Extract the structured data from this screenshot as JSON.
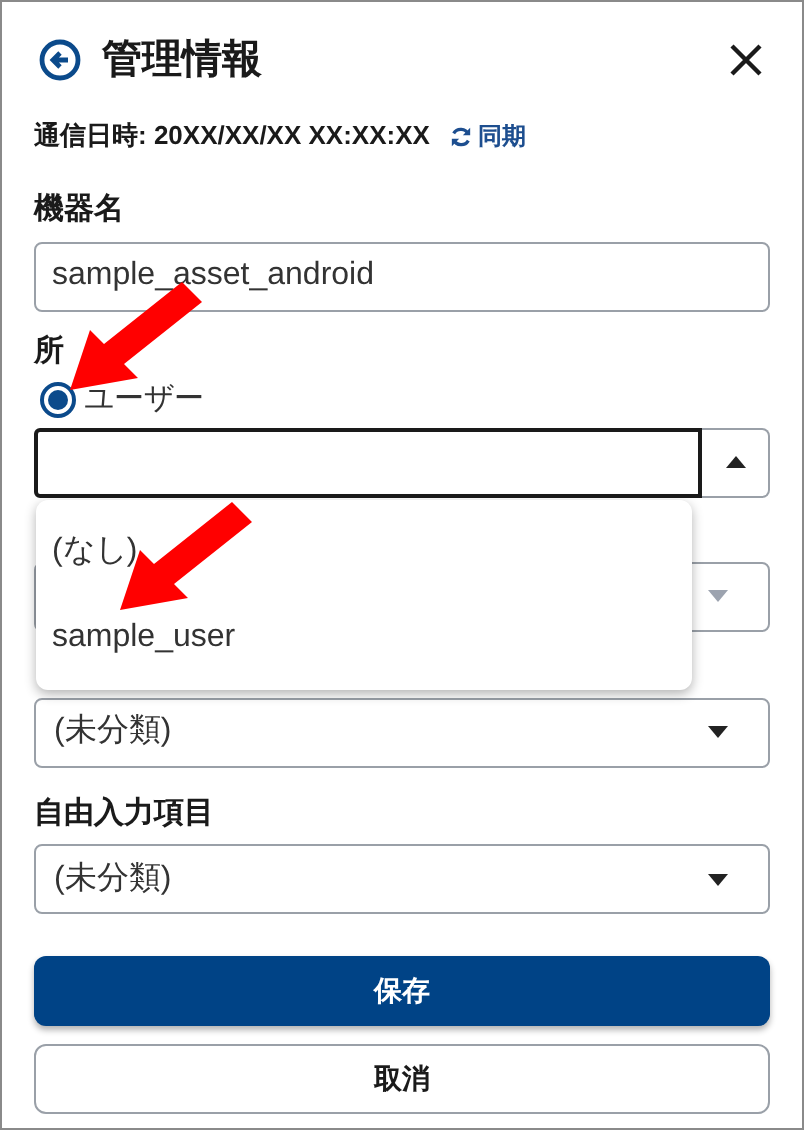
{
  "header": {
    "title": "管理情報"
  },
  "sync": {
    "label": "通信日時: 20XX/XX/XX XX:XX:XX",
    "action": "同期"
  },
  "device_name": {
    "label": "機器名",
    "value": "sample_asset_android"
  },
  "affiliation": {
    "label": "所",
    "radios": [
      {
        "label": "ユーザー",
        "selected": true
      }
    ],
    "combobox": {
      "expanded": true
    },
    "options": [
      {
        "label": "(なし)"
      },
      {
        "label": "sample_user"
      }
    ]
  },
  "hidden_select": {
    "disabled": true
  },
  "category_select": {
    "value": "(未分類)"
  },
  "free_input": {
    "label": "自由入力項目",
    "value": "(未分類)"
  },
  "buttons": [
    {
      "label": "保存",
      "kind": "primary"
    },
    {
      "label": "取消",
      "kind": "secondary"
    }
  ]
}
